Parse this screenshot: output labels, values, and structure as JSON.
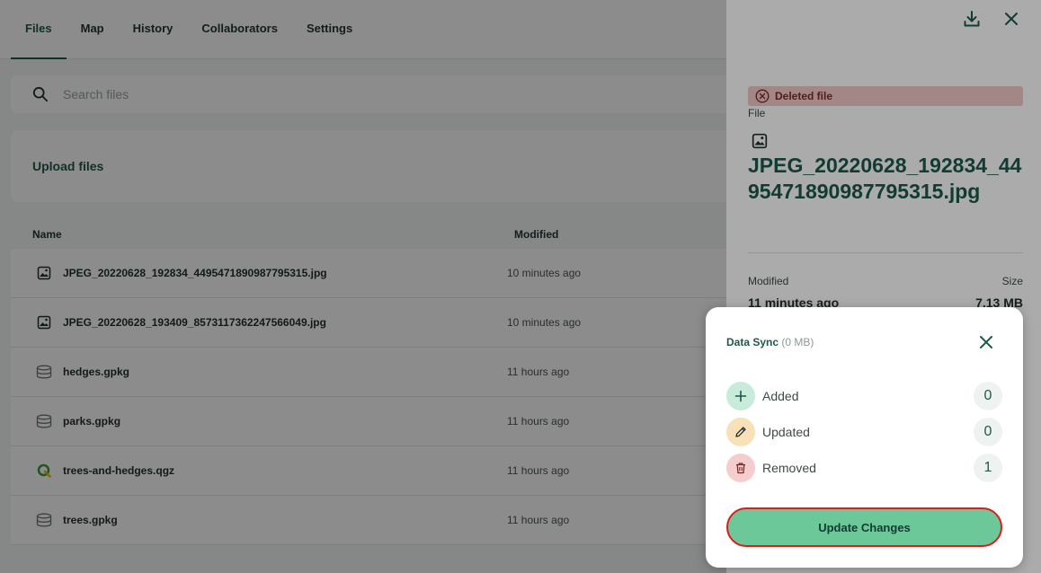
{
  "tabs": [
    {
      "label": "Files"
    },
    {
      "label": "Map"
    },
    {
      "label": "History"
    },
    {
      "label": "Collaborators"
    },
    {
      "label": "Settings"
    }
  ],
  "search": {
    "placeholder": "Search files"
  },
  "upload": {
    "label": "Upload files"
  },
  "table": {
    "headers": {
      "name": "Name",
      "modified": "Modified"
    },
    "rows": [
      {
        "name": "JPEG_20220628_192834_4495471890987795315.jpg",
        "modified": "10 minutes ago",
        "icon": "image-icon"
      },
      {
        "name": "JPEG_20220628_193409_8573117362247566049.jpg",
        "modified": "10 minutes ago",
        "icon": "image-icon"
      },
      {
        "name": "hedges.gpkg",
        "modified": "11 hours ago",
        "icon": "database-icon"
      },
      {
        "name": "parks.gpkg",
        "modified": "11 hours ago",
        "icon": "database-icon"
      },
      {
        "name": "trees-and-hedges.qgz",
        "modified": "11 hours ago",
        "icon": "qgis-icon"
      },
      {
        "name": "trees.gpkg",
        "modified": "11 hours ago",
        "icon": "database-icon"
      }
    ]
  },
  "panel": {
    "badge": "Deleted file",
    "file_label": "File",
    "file_name": "JPEG_20220628_192834_4495471890987795315.jpg",
    "modified_label": "Modified",
    "modified_value": "11 minutes ago",
    "size_label": "Size",
    "size_value": "7.13 MB"
  },
  "sync": {
    "title": "Data Sync",
    "size": "(0 MB)",
    "items": [
      {
        "label": "Added",
        "count": "0",
        "icon": "plus-icon",
        "color": "#c8ecd9"
      },
      {
        "label": "Updated",
        "count": "0",
        "icon": "pencil-icon",
        "color": "#f8e1b8"
      },
      {
        "label": "Removed",
        "count": "1",
        "icon": "trash-icon",
        "color": "#f6cdcd"
      }
    ],
    "button": "Update Changes"
  },
  "colors": {
    "accent": "#1c5a4c",
    "button_green": "#6cc898",
    "highlight_red": "#e01b1b"
  }
}
